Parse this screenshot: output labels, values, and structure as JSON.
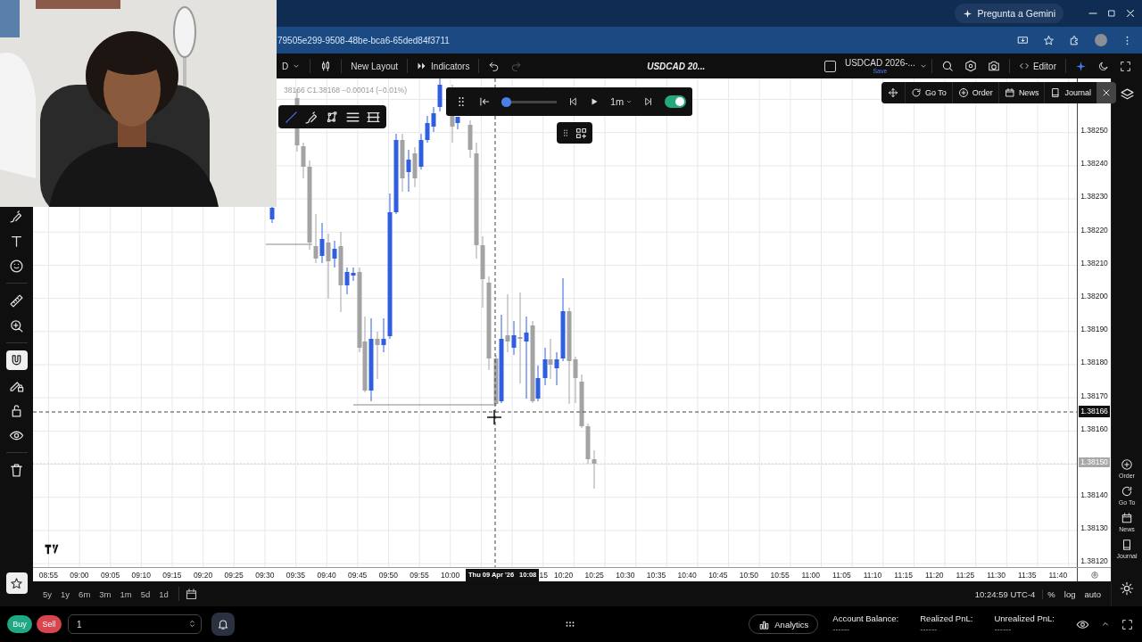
{
  "browser": {
    "assistant_button": "Pregunta a Gemini",
    "url": "79505e299-9508-48be-bca6-65ded84f3711"
  },
  "toolbar": {
    "layout_menu": "D",
    "checkbox_checked": false,
    "new_layout": "New Layout",
    "indicators": "Indicators",
    "chart_title": "USDCAD 20...",
    "layout_name": "USDCAD 2026-...",
    "layout_status": "Save",
    "editor": "Editor"
  },
  "legend": "38166 C1.38168 −0.00014 (−0.01%)",
  "replay": {
    "interval": "1m",
    "level": 0,
    "autoplay_on": true
  },
  "quick_panel": {
    "items": [
      "Go To",
      "Order",
      "News",
      "Journal"
    ]
  },
  "tool_groups": [
    [
      {
        "selected": false
      },
      {
        "selected": false
      },
      {
        "selected": false
      }
    ],
    [
      {
        "selected": false
      },
      {
        "selected": false
      }
    ],
    [
      {
        "selected": true
      },
      {
        "selected": false
      },
      {
        "selected": false
      },
      {
        "selected": false
      }
    ],
    [
      {
        "selected": false
      }
    ]
  ],
  "price_axis": {
    "labels": [
      {
        "text": "1.38250",
        "kind": "plain"
      },
      {
        "text": "1.38240",
        "kind": "plain"
      },
      {
        "text": "1.38230",
        "kind": "plain"
      },
      {
        "text": "1.38220",
        "kind": "plain"
      },
      {
        "text": "1.38210",
        "kind": "plain"
      },
      {
        "text": "1.38200",
        "kind": "plain"
      },
      {
        "text": "1.38190",
        "kind": "plain"
      },
      {
        "text": "1.38180",
        "kind": "plain"
      },
      {
        "text": "1.38170",
        "kind": "plain"
      },
      {
        "text": "1.38160",
        "kind": "plain"
      },
      {
        "text": "1.38150",
        "kind": "marker"
      },
      {
        "text": "1.38140",
        "kind": "plain"
      },
      {
        "text": "1.38130",
        "kind": "plain"
      },
      {
        "text": "1.38120",
        "kind": "plain"
      }
    ],
    "current_price": "1.38166"
  },
  "time_axis": {
    "labels_before": [
      "08:55",
      "09:00",
      "09:05",
      "09:10",
      "09:15",
      "09:20",
      "09:25",
      "09:30",
      "09:35",
      "09:40",
      "09:45",
      "09:50",
      "09:55",
      "10:00"
    ],
    "crosshair_date": "Thu 09 Apr '26",
    "crosshair_time": "10:08",
    "labels_after": [
      "15",
      "10:20",
      "10:25",
      "10:30",
      "10:35",
      "10:40",
      "10:45",
      "10:50",
      "10:55",
      "11:00",
      "11:05",
      "11:10",
      "11:15",
      "11:20",
      "11:25",
      "11:30",
      "11:35",
      "11:40"
    ]
  },
  "ranges": [
    "5y",
    "1y",
    "6m",
    "3m",
    "1m",
    "5d",
    "1d"
  ],
  "clock": "10:24:59 UTC-4",
  "scale_options": [
    "%",
    "log",
    "auto"
  ],
  "trade_bar": {
    "buy": "Buy",
    "sell": "Sell",
    "quantity": "1",
    "analytics": "Analytics",
    "stats": [
      {
        "label": "Account Balance:",
        "value": "------"
      },
      {
        "label": "Realized PnL:",
        "value": "------"
      },
      {
        "label": "Unrealized PnL:",
        "value": "------"
      }
    ]
  },
  "side_panel": [
    "Order",
    "Go To",
    "News",
    "Journal"
  ]
}
